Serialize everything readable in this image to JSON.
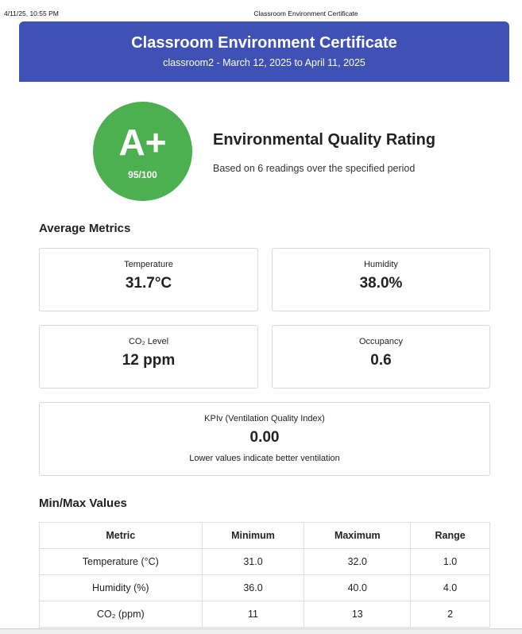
{
  "print_header": {
    "datetime": "4/11/25, 10:55 PM",
    "doc_title": "Classroom Environment Certificate"
  },
  "banner": {
    "title": "Classroom Environment Certificate",
    "subtitle": "classroom2 - March 12, 2025 to April 11, 2025"
  },
  "rating": {
    "grade": "A+",
    "score": "95/100",
    "title": "Environmental Quality Rating",
    "description": "Based on 6 readings over the specified period",
    "badge_color": "#4caf50"
  },
  "average_metrics": {
    "section_title": "Average Metrics",
    "temperature": {
      "label": "Temperature",
      "value": "31.7°C"
    },
    "humidity": {
      "label": "Humidity",
      "value": "38.0%"
    },
    "co2": {
      "label": "CO₂ Level",
      "value": "12 ppm"
    },
    "occupancy": {
      "label": "Occupancy",
      "value": "0.6"
    },
    "kpiv": {
      "label": "KPIv (Ventilation Quality Index)",
      "value": "0.00",
      "note": "Lower values indicate better ventilation"
    }
  },
  "minmax": {
    "section_title": "Min/Max Values",
    "headers": [
      "Metric",
      "Minimum",
      "Maximum",
      "Range"
    ],
    "rows": [
      [
        "Temperature (°C)",
        "31.0",
        "32.0",
        "1.0"
      ],
      [
        "Humidity (%)",
        "36.0",
        "40.0",
        "4.0"
      ],
      [
        "CO₂ (ppm)",
        "11",
        "13",
        "2"
      ]
    ]
  },
  "colors": {
    "banner": "#3f51b5",
    "grade_badge": "#4caf50"
  }
}
